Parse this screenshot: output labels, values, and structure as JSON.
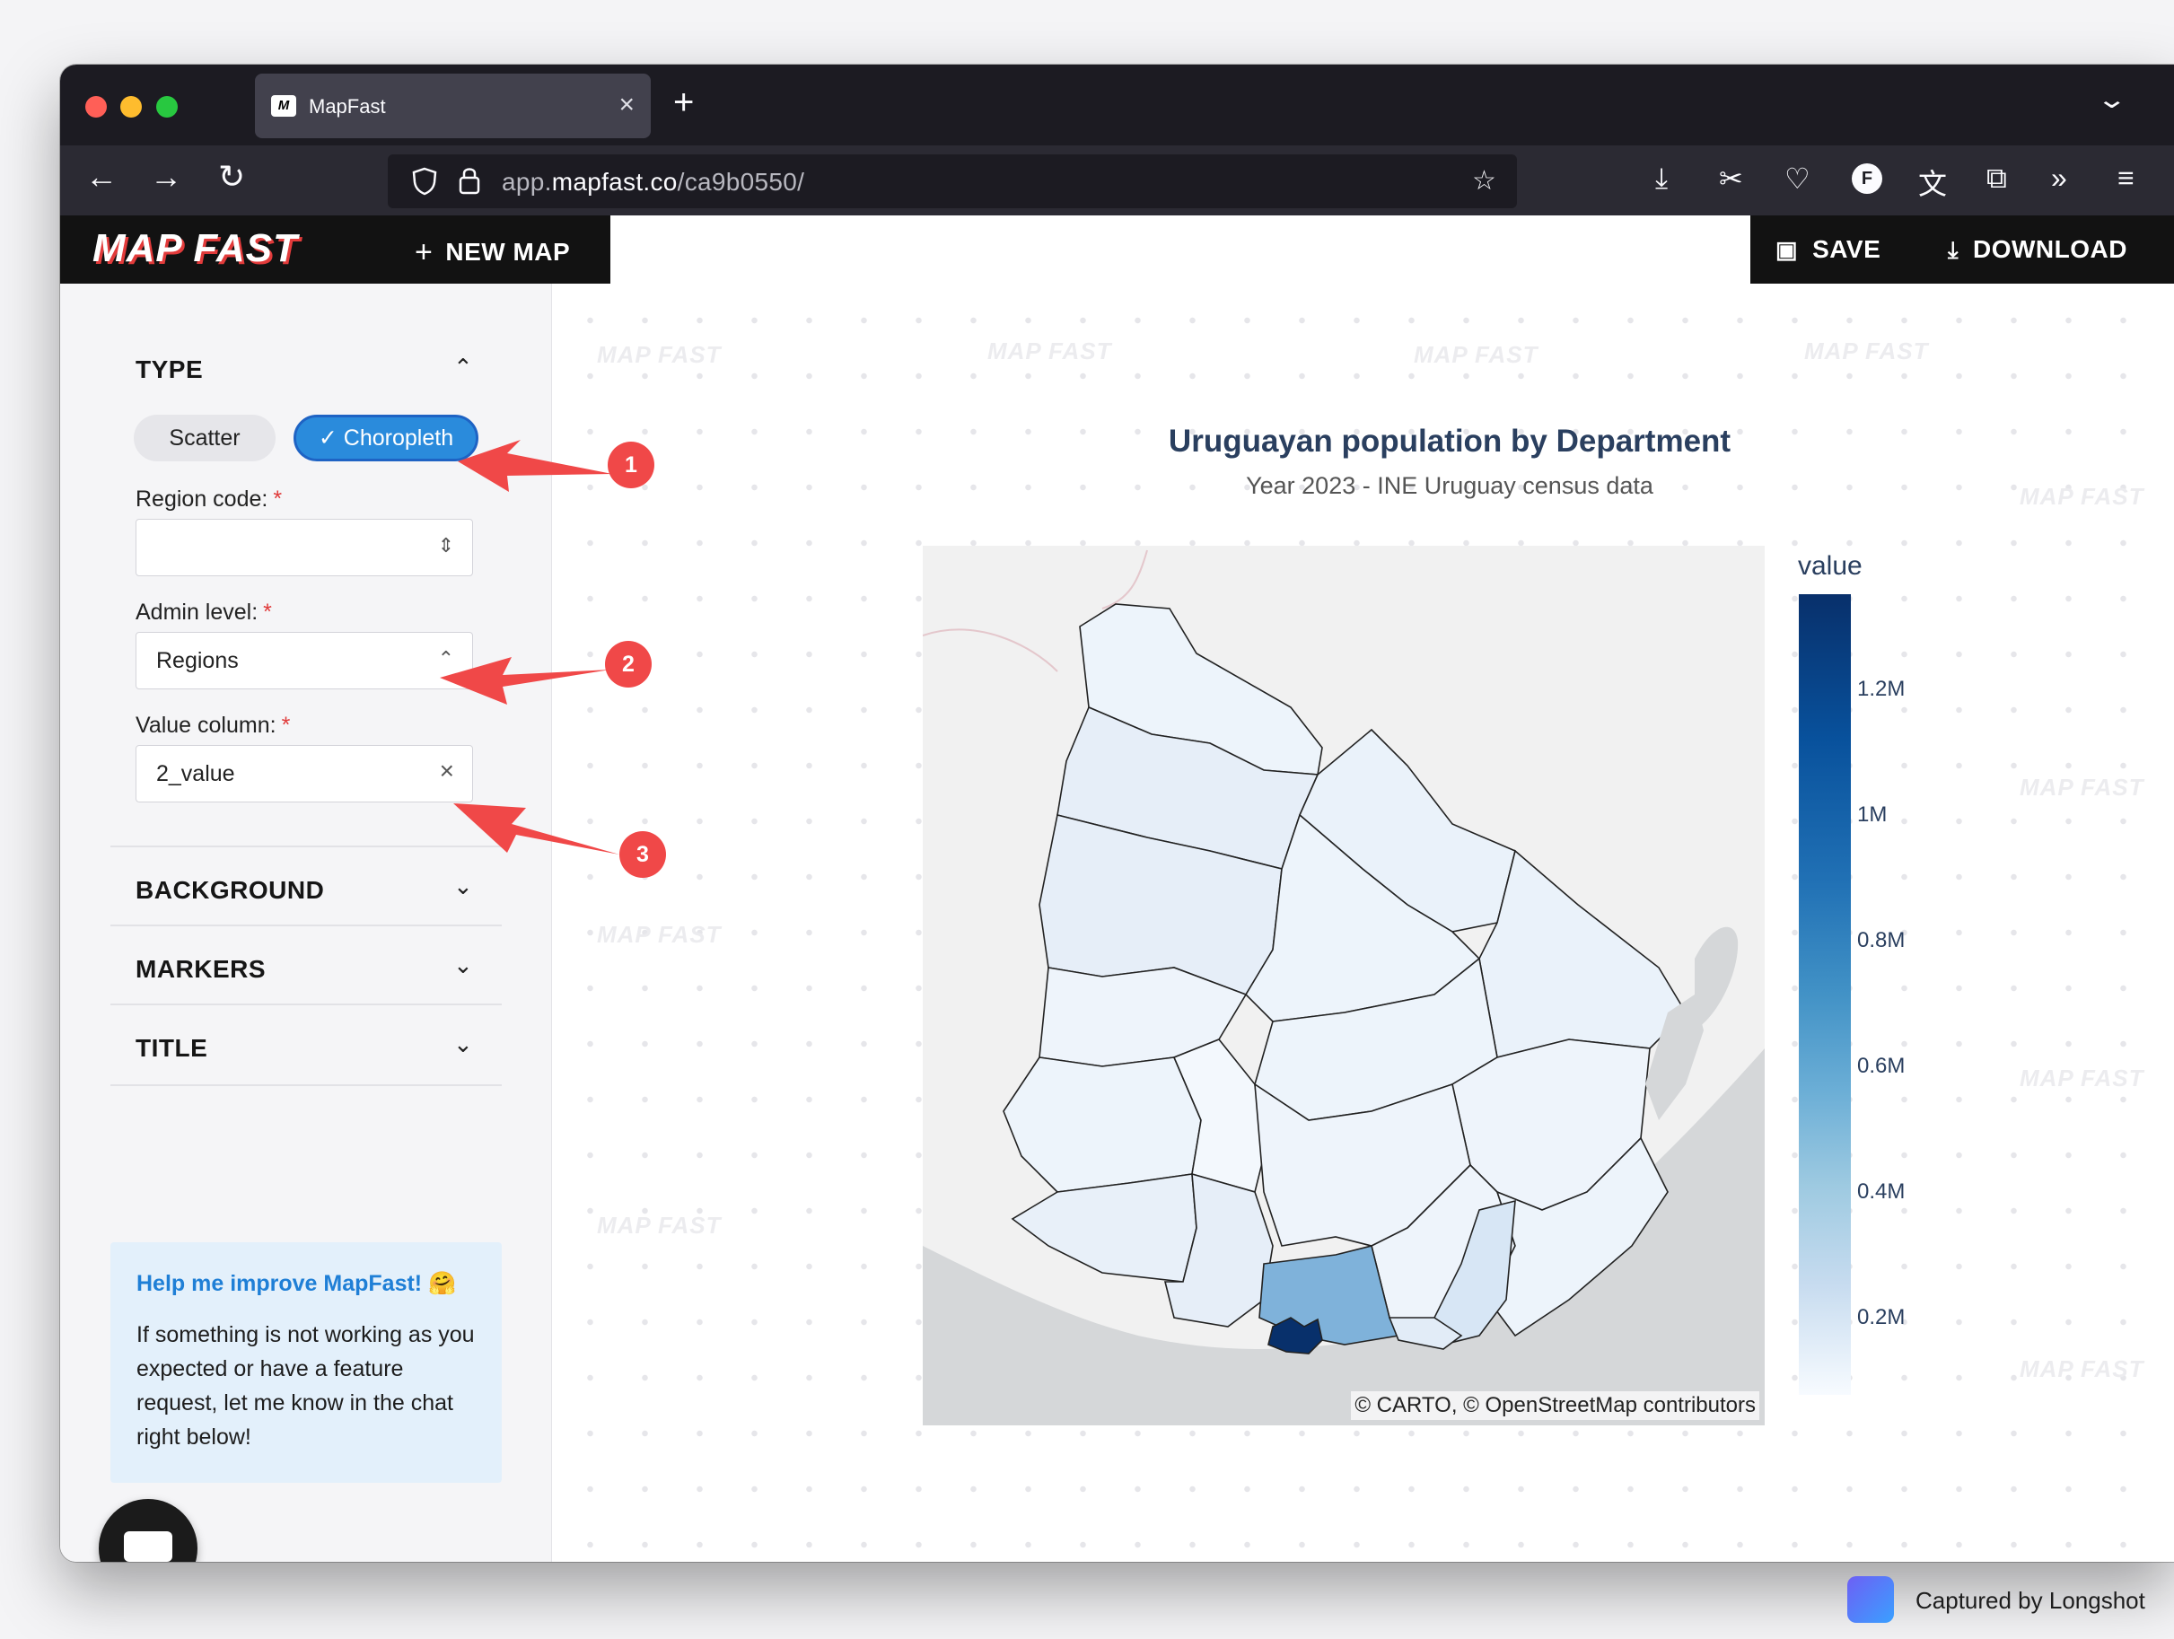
{
  "browser": {
    "tab_title": "MapFast",
    "url_path": "app.",
    "url_host": "mapfast.co",
    "url_rest": "/ca9b0550/"
  },
  "header": {
    "logo": "MAP FAST",
    "new_map": "NEW MAP",
    "save": "SAVE",
    "download": "DOWNLOAD"
  },
  "sidebar": {
    "type_section": "TYPE",
    "type_options": [
      "Scatter",
      "Choropleth"
    ],
    "selected_type": "Choropleth",
    "region_code_label": "Region code:",
    "region_code_value": "",
    "admin_level_label": "Admin level:",
    "admin_level_value": "Regions",
    "value_column_label": "Value column:",
    "value_column_value": "2_value",
    "required_mark": "*",
    "sections": [
      "BACKGROUND",
      "MARKERS",
      "TITLE"
    ],
    "help_title": "Help me improve MapFast! 🤗",
    "help_body": "If something is not working as you expected or have a feature request, let me know in the chat right below!"
  },
  "map": {
    "title": "Uruguayan population by Department",
    "subtitle": "Year 2023 - INE Uruguay census data",
    "attribution": "© CARTO, © OpenStreetMap contributors",
    "watermark": "MAP FAST",
    "colorbar": {
      "title": "value",
      "ticks": [
        "1.2M",
        "1M",
        "0.8M",
        "0.6M",
        "0.4M",
        "0.2M"
      ],
      "color_max": "#08306b",
      "color_min": "#f7fbff"
    }
  },
  "annotations": [
    "1",
    "2",
    "3"
  ],
  "footer": {
    "captured": "Captured by Longshot"
  }
}
